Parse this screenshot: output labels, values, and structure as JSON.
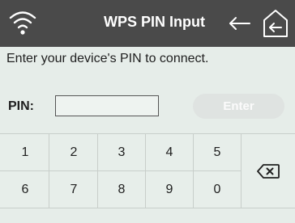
{
  "header": {
    "title": "WPS PIN Input",
    "icons": [
      "wifi-icon",
      "back-arrow-icon",
      "home-icon"
    ]
  },
  "prompt": "Enter your device's PIN to connect.",
  "pin": {
    "label": "PIN:",
    "value": ""
  },
  "enter_button": {
    "label": "Enter",
    "enabled": false
  },
  "keypad": {
    "row1": [
      "1",
      "2",
      "3",
      "4",
      "5"
    ],
    "row2": [
      "6",
      "7",
      "8",
      "9",
      "0"
    ],
    "delete_icon": "backspace-icon"
  },
  "colors": {
    "titlebar": "#4a4a4a",
    "background": "#e6ede9",
    "enter_disabled": "#dfe3e1"
  }
}
